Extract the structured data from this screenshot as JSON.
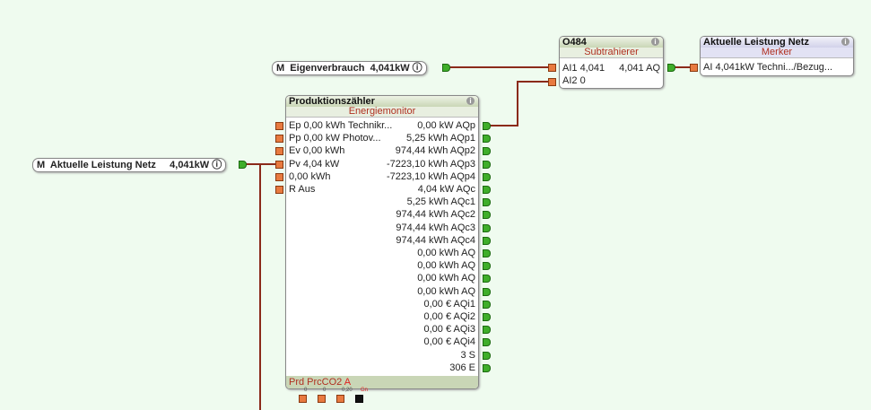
{
  "colors": {
    "background": "#effbef",
    "wire": "#8b2a1a",
    "input_port": "#e87a40",
    "output_port": "#3fae2a"
  },
  "memory_eigenverbrauch": {
    "prefix": "M",
    "name": "Eigenverbrauch",
    "value": "4,041kW"
  },
  "memory_netz": {
    "prefix": "M",
    "name": "Aktuelle Leistung Netz",
    "value": "4,041kW"
  },
  "subtrahierer": {
    "title": "O484",
    "type": "Subtrahierer",
    "in1": "AI1 4,041",
    "out": "4,041 AQ",
    "in2": "AI2 0"
  },
  "merker": {
    "title": "Aktuelle Leistung Netz",
    "type": "Merker",
    "in": "AI 4,041kW Techni.../Bezug..."
  },
  "energiemonitor": {
    "title": "Produktionszähler",
    "type": "Energiemonitor",
    "inputs": [
      "Ep 0,00 kWh Technikr...",
      "Pp 0,00 kW Photov...",
      "Ev 0,00 kWh",
      "Pv 4,04 kW",
      " 0,00 kWh",
      "R Aus"
    ],
    "outputs": [
      "0,00 kW AQp",
      "5,25 kWh AQp1",
      "974,44 kWh AQp2",
      "-7223,10 kWh AQp3",
      "-7223,10 kWh AQp4",
      "4,04 kW AQc",
      "5,25 kWh AQc1",
      "974,44 kWh AQc2",
      "974,44 kWh AQc3",
      "974,44 kWh AQc4",
      "0,00 kWh AQ",
      "0,00 kWh AQ",
      "0,00 kWh AQ",
      "0,00 kWh AQ",
      "0,00 € AQi1",
      "0,00 € AQi2",
      "0,00 € AQi3",
      "0,00 € AQi4",
      "3 S",
      "306 E"
    ],
    "footer_params": "Prd PrcCO2",
    "footer_flag": "A",
    "param_values": [
      "0",
      "0",
      "0,20",
      "Gn"
    ]
  }
}
